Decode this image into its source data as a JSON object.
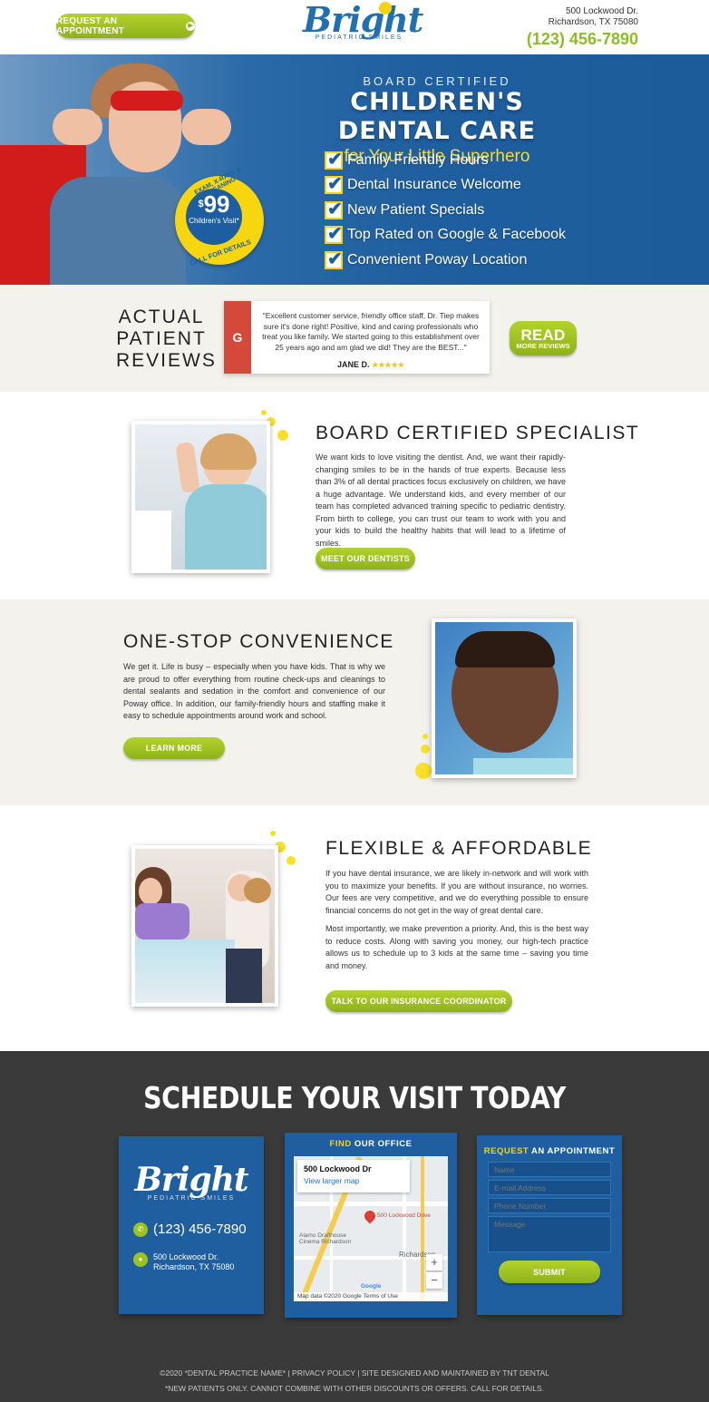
{
  "header": {
    "appointment_button": "REQUEST AN APPOINTMENT",
    "logo_word": "Bright",
    "logo_sub": "PEDIATRIC SMILES",
    "address_line1": "500 Lockwood Dr.",
    "address_line2": "Richardson, TX 75080",
    "phone": "(123) 456-7890"
  },
  "hero": {
    "kicker": "BOARD CERTIFIED",
    "title": "CHILDREN'S DENTAL CARE",
    "subtitle": "for Your Little Superhero",
    "checks": [
      "Family Friendly Hours",
      "Dental Insurance Welcome",
      "New Patient Specials",
      "Top Rated on Google & Facebook",
      "Convenient Poway Location"
    ],
    "badge": {
      "top": "EXAM, X-RAYS & CLEANING",
      "currency": "$",
      "price": "99",
      "sub": "Children's Visit*",
      "bottom": "CALL FOR DETAILS"
    }
  },
  "reviews": {
    "heading_1": "ACTUAL",
    "heading_2": "PATIENT",
    "heading_3": "REVIEWS",
    "source_icon": "G",
    "quote": "\"Excellent customer service, friendly office staff, Dr. Tiep makes sure it's done right! Positive, kind and caring professionals who treat you like family. We started going to this establishment over 25 years ago and am glad we did! They are the BEST...\"",
    "author": "JANE D.",
    "stars": "★★★★★",
    "rating": 5,
    "read_big": "READ",
    "read_small": "MORE REVIEWS"
  },
  "sections": [
    {
      "title": "BOARD CERTIFIED SPECIALIST",
      "paragraphs": [
        "We want kids to love visiting the dentist. And, we want their rapidly-changing smiles to be in the hands of true experts. Because less than 3% of all dental practices focus exclusively on children, we have a huge advantage. We understand kids, and every member of our team has completed advanced training specific to pediatric dentistry. From birth to college, you can trust our team to work with you and your kids to build the healthy habits that will lead to a lifetime of smiles."
      ],
      "button": "MEET OUR DENTISTS"
    },
    {
      "title": "ONE-STOP CONVENIENCE",
      "paragraphs": [
        "We get it. Life is busy – especially when you have kids. That is why we are proud to offer everything from routine check-ups and cleanings to dental sealants and sedation in the comfort and convenience of our Poway office. In addition, our family-friendly hours and staffing make it easy to schedule appointments around work and school."
      ],
      "button": "LEARN MORE"
    },
    {
      "title": "FLEXIBLE & AFFORDABLE",
      "paragraphs": [
        "If you have dental insurance, we are likely in-network and will work with you to maximize your benefits. If you are without insurance, no worries. Our fees are very competitive, and we do everything possible to ensure financial concerns do not get in the way of great dental care.",
        "Most importantly, we make prevention a priority. And, this is the best way to reduce costs. Along with saving you money, our high-tech practice allows us to schedule up to 3 kids at the same time – saving you time and money."
      ],
      "button": "TALK TO OUR INSURANCE COORDINATOR"
    }
  ],
  "schedule": {
    "title": "SCHEDULE YOUR VISIT TODAY",
    "contact_phone": "(123) 456-7890",
    "contact_addr1": "500 Lockwood Dr.",
    "contact_addr2": "Richardson, TX 75080",
    "find_y": "FIND",
    "find_w": "OUR OFFICE",
    "map_place": "500 Lockwood Dr",
    "map_link": "View larger map",
    "map_pin_label": "500 Lockwood Drive",
    "map_labels": [
      "Alamo Drafthouse Cinema Richardson",
      "Richardson",
      "Google",
      "Map data ©2020 Google",
      "Terms of Use"
    ],
    "request_y": "REQUEST",
    "request_w": "AN APPOINTMENT",
    "form": {
      "name": "Name",
      "email": "E-mail Address",
      "phone": "Phone Number",
      "message": "Message",
      "submit": "SUBMIT"
    }
  },
  "footer": {
    "line1": "©2020 *DENTAL PRACTICE NAME* | PRIVACY POLICY | SITE DESIGNED AND MAINTAINED BY TNT DENTAL",
    "line2": "*NEW PATIENTS ONLY. CANNOT COMBINE WITH OTHER DISCOUNTS OR OFFERS. CALL FOR DETAILS."
  },
  "colors": {
    "brand_blue": "#1f5fa0",
    "accent_green": "#8cbe23",
    "accent_yellow": "#f5d311"
  }
}
